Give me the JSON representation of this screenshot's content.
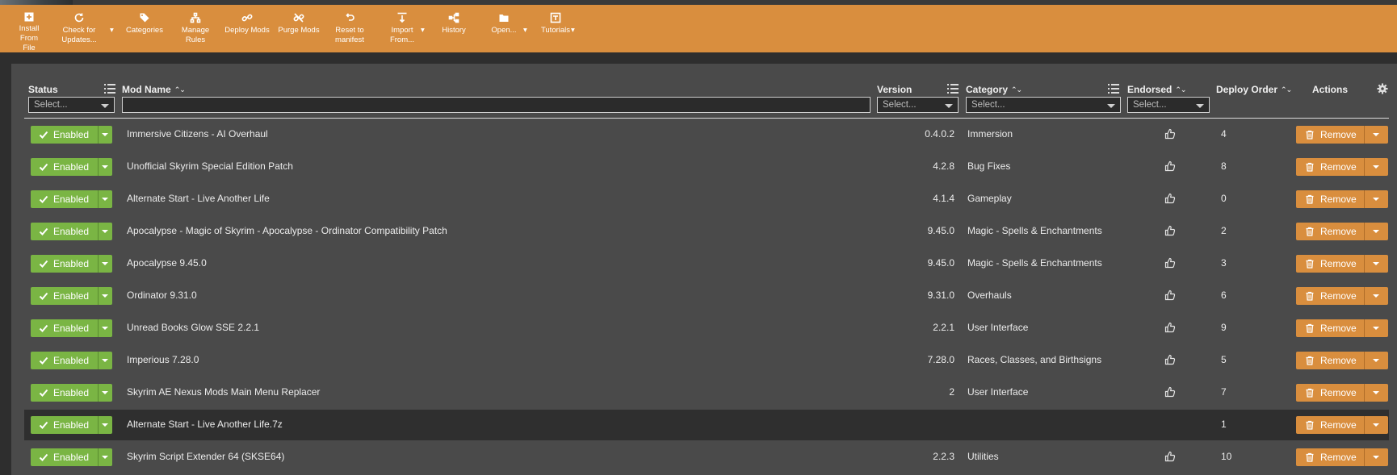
{
  "toolbar": {
    "items": [
      {
        "label": "Install From\nFile",
        "icon": "plus-square-icon"
      },
      {
        "label": "Check for\nUpdates...",
        "icon": "refresh-icon",
        "has_dropdown": true
      },
      {
        "label": "Categories",
        "icon": "tag-icon"
      },
      {
        "label": "Manage\nRules",
        "icon": "rules-icon"
      },
      {
        "label": "Deploy Mods",
        "icon": "link-icon"
      },
      {
        "label": "Purge Mods",
        "icon": "unlink-icon"
      },
      {
        "label": "Reset to\nmanifest",
        "icon": "undo-icon"
      },
      {
        "label": "Import\nFrom...",
        "icon": "import-icon",
        "has_dropdown": true
      },
      {
        "label": "History",
        "icon": "history-icon"
      },
      {
        "label": "Open...",
        "icon": "folder-icon",
        "has_dropdown": true
      },
      {
        "label": "Tutorials",
        "icon": "tutorial-icon",
        "has_dropdown": true
      }
    ]
  },
  "columns": {
    "status": "Status",
    "mod_name": "Mod Name",
    "version": "Version",
    "category": "Category",
    "endorsed": "Endorsed",
    "deploy_order": "Deploy Order",
    "actions": "Actions"
  },
  "filters": {
    "status_placeholder": "Select...",
    "version_placeholder": "Select...",
    "category_placeholder": "Select...",
    "endorsed_placeholder": "Select...",
    "name_value": ""
  },
  "labels": {
    "enabled": "Enabled",
    "remove": "Remove"
  },
  "colors": {
    "accent": "#d98e3e",
    "enabled": "#7ab544",
    "panel": "#4a4a4a",
    "selected_row": "#2f2f2f"
  },
  "rows": [
    {
      "name": "Immersive Citizens - AI Overhaul",
      "version": "0.4.0.2",
      "category": "Immersion",
      "endorse": true,
      "order": "4"
    },
    {
      "name": "Unofficial Skyrim Special Edition Patch",
      "version": "4.2.8",
      "category": "Bug Fixes",
      "endorse": true,
      "order": "8"
    },
    {
      "name": "Alternate Start - Live Another Life",
      "version": "4.1.4",
      "category": "Gameplay",
      "endorse": true,
      "order": "0"
    },
    {
      "name": "Apocalypse - Magic of Skyrim - Apocalypse - Ordinator Compatibility Patch",
      "version": "9.45.0",
      "category": "Magic - Spells & Enchantments",
      "endorse": true,
      "order": "2"
    },
    {
      "name": "Apocalypse 9.45.0",
      "version": "9.45.0",
      "category": "Magic - Spells & Enchantments",
      "endorse": true,
      "order": "3"
    },
    {
      "name": "Ordinator 9.31.0",
      "version": "9.31.0",
      "category": "Overhauls",
      "endorse": true,
      "order": "6"
    },
    {
      "name": "Unread Books Glow SSE 2.2.1",
      "version": "2.2.1",
      "category": "User Interface",
      "endorse": true,
      "order": "9"
    },
    {
      "name": "Imperious 7.28.0",
      "version": "7.28.0",
      "category": "Races, Classes, and Birthsigns",
      "endorse": true,
      "order": "5"
    },
    {
      "name": "Skyrim AE Nexus Mods Main Menu Replacer",
      "version": "2",
      "category": "User Interface",
      "endorse": true,
      "order": "7"
    },
    {
      "name": "Alternate Start - Live Another Life.7z",
      "version": "",
      "category": "",
      "endorse": false,
      "order": "1",
      "selected": true
    },
    {
      "name": "Skyrim Script Extender 64 (SKSE64)",
      "version": "2.2.3",
      "category": "Utilities",
      "endorse": true,
      "order": "10"
    }
  ]
}
